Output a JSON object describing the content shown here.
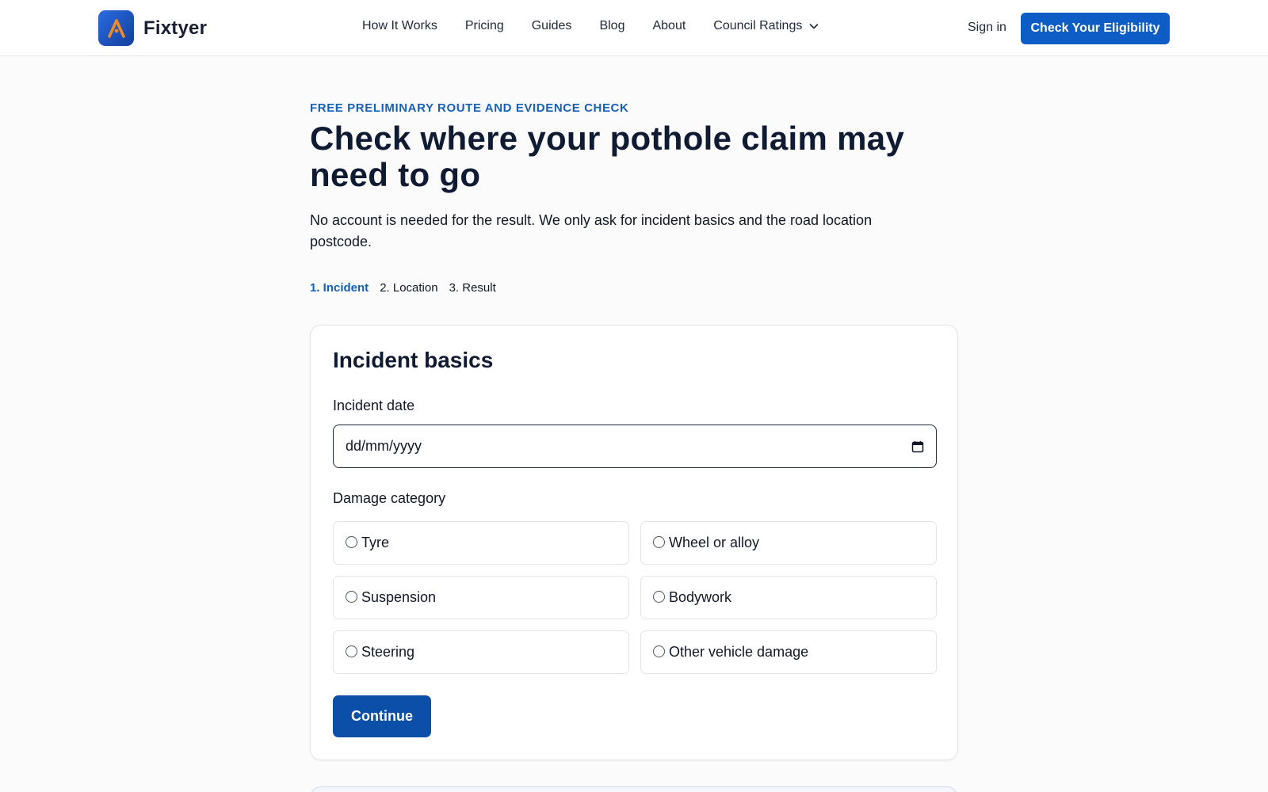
{
  "header": {
    "brand": "Fixtyer",
    "nav": [
      {
        "label": "How It Works"
      },
      {
        "label": "Pricing"
      },
      {
        "label": "Guides"
      },
      {
        "label": "Blog"
      },
      {
        "label": "About"
      },
      {
        "label": "Council Ratings",
        "has_dropdown": true
      }
    ],
    "signin_label": "Sign in",
    "cta_label": "Check Your Eligibility",
    "icons": {
      "logo": "fixtyer-logo-icon",
      "dropdown": "chevron-down-icon"
    }
  },
  "hero": {
    "eyebrow": "FREE PRELIMINARY ROUTE AND EVIDENCE CHECK",
    "title": "Check where your pothole claim may need to go",
    "lede": "No account is needed for the result. We only ask for incident basics and the road location postcode."
  },
  "steps": [
    {
      "label": "1. Incident",
      "active": true
    },
    {
      "label": "2. Location",
      "active": false
    },
    {
      "label": "3. Result",
      "active": false
    }
  ],
  "form": {
    "title": "Incident basics",
    "date_label": "Incident date",
    "date_placeholder": "dd/mm/yyyy",
    "category_label": "Damage category",
    "categories": [
      "Tyre",
      "Wheel or alloy",
      "Suspension",
      "Bodywork",
      "Steering",
      "Other vehicle damage"
    ],
    "continue_label": "Continue",
    "icons": {
      "date": "calendar-icon"
    }
  },
  "colors": {
    "primary": "#0e5dc7",
    "primary_dark": "#0b4fa8",
    "accent_text": "#1560b9",
    "logo_accent": "#f08a24",
    "heading": "#0f1b33"
  }
}
